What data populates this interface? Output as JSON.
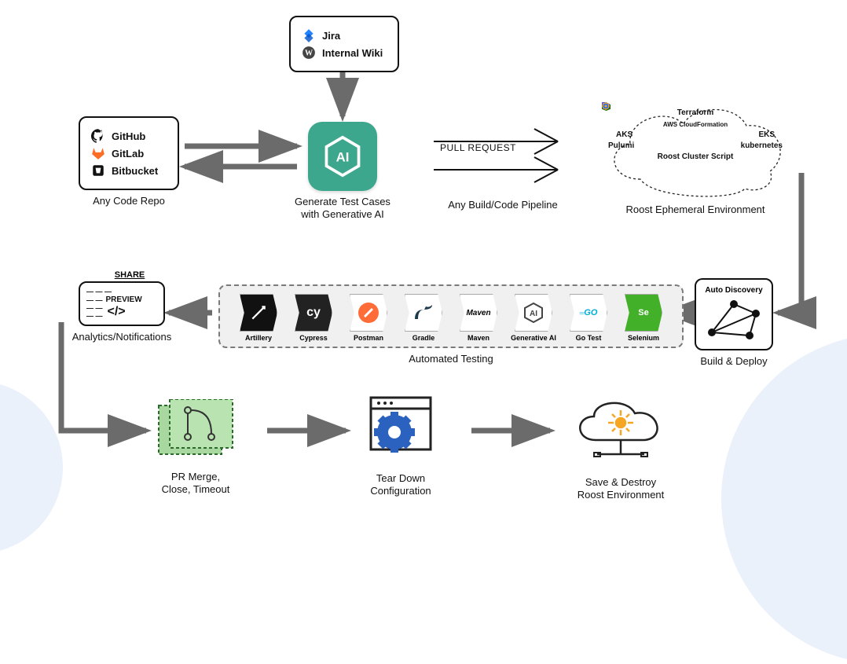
{
  "nodes": {
    "sources": {
      "label": "Any Code Repo",
      "items": [
        "GitHub",
        "GitLab",
        "Bitbucket"
      ]
    },
    "docs": {
      "items": [
        "Jira",
        "Internal Wiki"
      ]
    },
    "ai": {
      "label_l1": "Generate Test Cases",
      "label_l2": "with Generative AI",
      "badge": "AI"
    },
    "pipeline": {
      "label": "Any Build/Code Pipeline",
      "arrow_text": "PULL REQUEST"
    },
    "env": {
      "label": "Roost Ephemeral Environment",
      "tools": [
        "Terraform",
        "AWS CloudFormation",
        "AKS",
        "EKS",
        "Pulumi",
        "kubernetes",
        "Roost Cluster Script"
      ]
    },
    "build": {
      "title": "Auto Discovery",
      "label": "Build & Deploy"
    },
    "testing": {
      "label": "Automated Testing",
      "tools": [
        "Artillery",
        "Cypress",
        "Postman",
        "Gradle",
        "Maven",
        "Generative AI",
        "Go Test",
        "Selenium"
      ]
    },
    "analytics": {
      "share": "SHARE",
      "preview": "PREVIEW",
      "label": "Analytics/Notifications"
    },
    "pr": {
      "label_l1": "PR Merge,",
      "label_l2": "Close, Timeout"
    },
    "teardown": {
      "label_l1": "Tear Down",
      "label_l2": "Configuration"
    },
    "save": {
      "label_l1": "Save & Destroy",
      "label_l2": "Roost Environment"
    }
  },
  "colors": {
    "accent": "#3da78e",
    "arrow": "#6b6b6b",
    "gitlab": "#fc6d26",
    "selenium": "#43b02a",
    "postman": "#ff6c37",
    "gear": "#2b62c0"
  }
}
